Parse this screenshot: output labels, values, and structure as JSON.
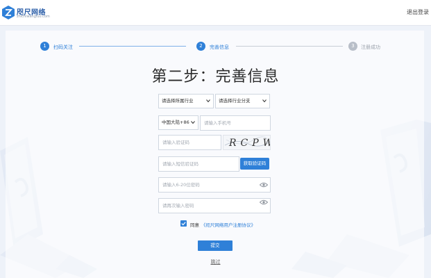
{
  "header": {
    "logo_name": "咫尺网络",
    "logo_domain": "zhichiwangluo.com",
    "logout": "退出登录"
  },
  "steps": [
    {
      "num": "1",
      "label": "扫码关注"
    },
    {
      "num": "2",
      "label": "完善信息"
    },
    {
      "num": "3",
      "label": "注册成功"
    }
  ],
  "title": "第二步：完善信息",
  "form": {
    "industry_select": "请选择所属行业",
    "industry_sub_select": "请选择行业分支",
    "region_select": "中国大陆+86",
    "phone_placeholder": "请输入手机号",
    "captcha_placeholder": "请输入验证码",
    "captcha_text": "RCPW",
    "sms_placeholder": "请输入短信验证码",
    "sms_button": "获取验证码",
    "password_placeholder": "请输入6-20位密码",
    "password_confirm_placeholder": "请再次输入密码",
    "agree_label": "同意",
    "agreement_link": "《咫尺网络用户注册协议》",
    "submit": "提交",
    "skip": "跳过"
  },
  "colors": {
    "accent": "#2f80d8",
    "inactive": "#b8bec8"
  }
}
